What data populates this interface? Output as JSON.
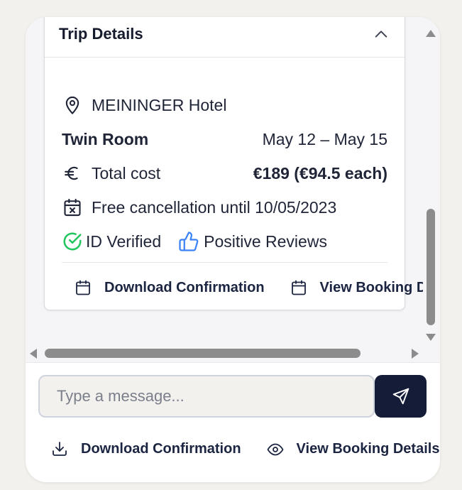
{
  "card": {
    "title": "Trip Details",
    "hotel": "MEININGER Hotel",
    "room": "Twin Room",
    "dates": "May 12 – May 15",
    "total_label": "Total cost",
    "total_value": "€189 (€94.5 each)",
    "cancellation": "Free cancellation until 10/05/2023",
    "badges": [
      {
        "label": "ID Verified",
        "icon": "check-circle-icon",
        "color": "#22c55e"
      },
      {
        "label": "Positive Reviews",
        "icon": "thumbs-up-icon",
        "color": "#3b82f6"
      }
    ],
    "actions": [
      {
        "label": "Download Confirmation",
        "icon": "calendar-icon"
      },
      {
        "label": "View Booking Details",
        "icon": "calendar-icon"
      }
    ]
  },
  "composer": {
    "placeholder": "Type a message...",
    "send_icon": "send-icon",
    "send_color": "#141c38"
  },
  "footer": {
    "actions": [
      {
        "label": "Download Confirmation",
        "icon": "download-icon"
      },
      {
        "label": "View Booking Details",
        "icon": "eye-icon"
      }
    ]
  }
}
